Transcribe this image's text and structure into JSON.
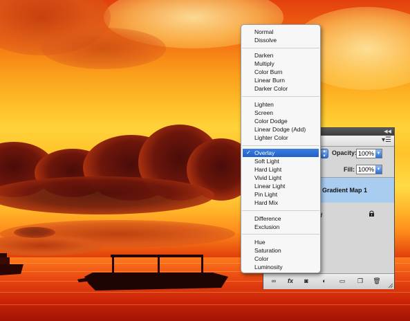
{
  "blend_menu": {
    "groups": [
      [
        "Normal",
        "Dissolve"
      ],
      [
        "Darken",
        "Multiply",
        "Color Burn",
        "Linear Burn",
        "Darker Color"
      ],
      [
        "Lighten",
        "Screen",
        "Color Dodge",
        "Linear Dodge (Add)",
        "Lighter Color"
      ],
      [
        "Overlay",
        "Soft Light",
        "Hard Light",
        "Vivid Light",
        "Linear Light",
        "Pin Light",
        "Hard Mix"
      ],
      [
        "Difference",
        "Exclusion"
      ],
      [
        "Hue",
        "Saturation",
        "Color",
        "Luminosity"
      ]
    ],
    "selected": "Overlay",
    "checkmark": "✓"
  },
  "layers_panel": {
    "opacity_label": "Opacity:",
    "opacity_value": "100%",
    "fill_label": "Fill:",
    "fill_value": "100%",
    "layers": [
      {
        "name": "Gradient Map 1",
        "selected": true
      },
      {
        "name": "d",
        "locked": true
      }
    ],
    "footer_icons": [
      "link-icon",
      "fx-icon",
      "mask-icon",
      "adjustment-icon",
      "folder-icon",
      "new-layer-icon",
      "trash-icon"
    ],
    "fx_label": "fx"
  },
  "colors": {
    "selection_highlight": "#2f6fd6",
    "selected_layer_row": "#a9cdf1",
    "panel_bg": "#d6d6d6"
  }
}
